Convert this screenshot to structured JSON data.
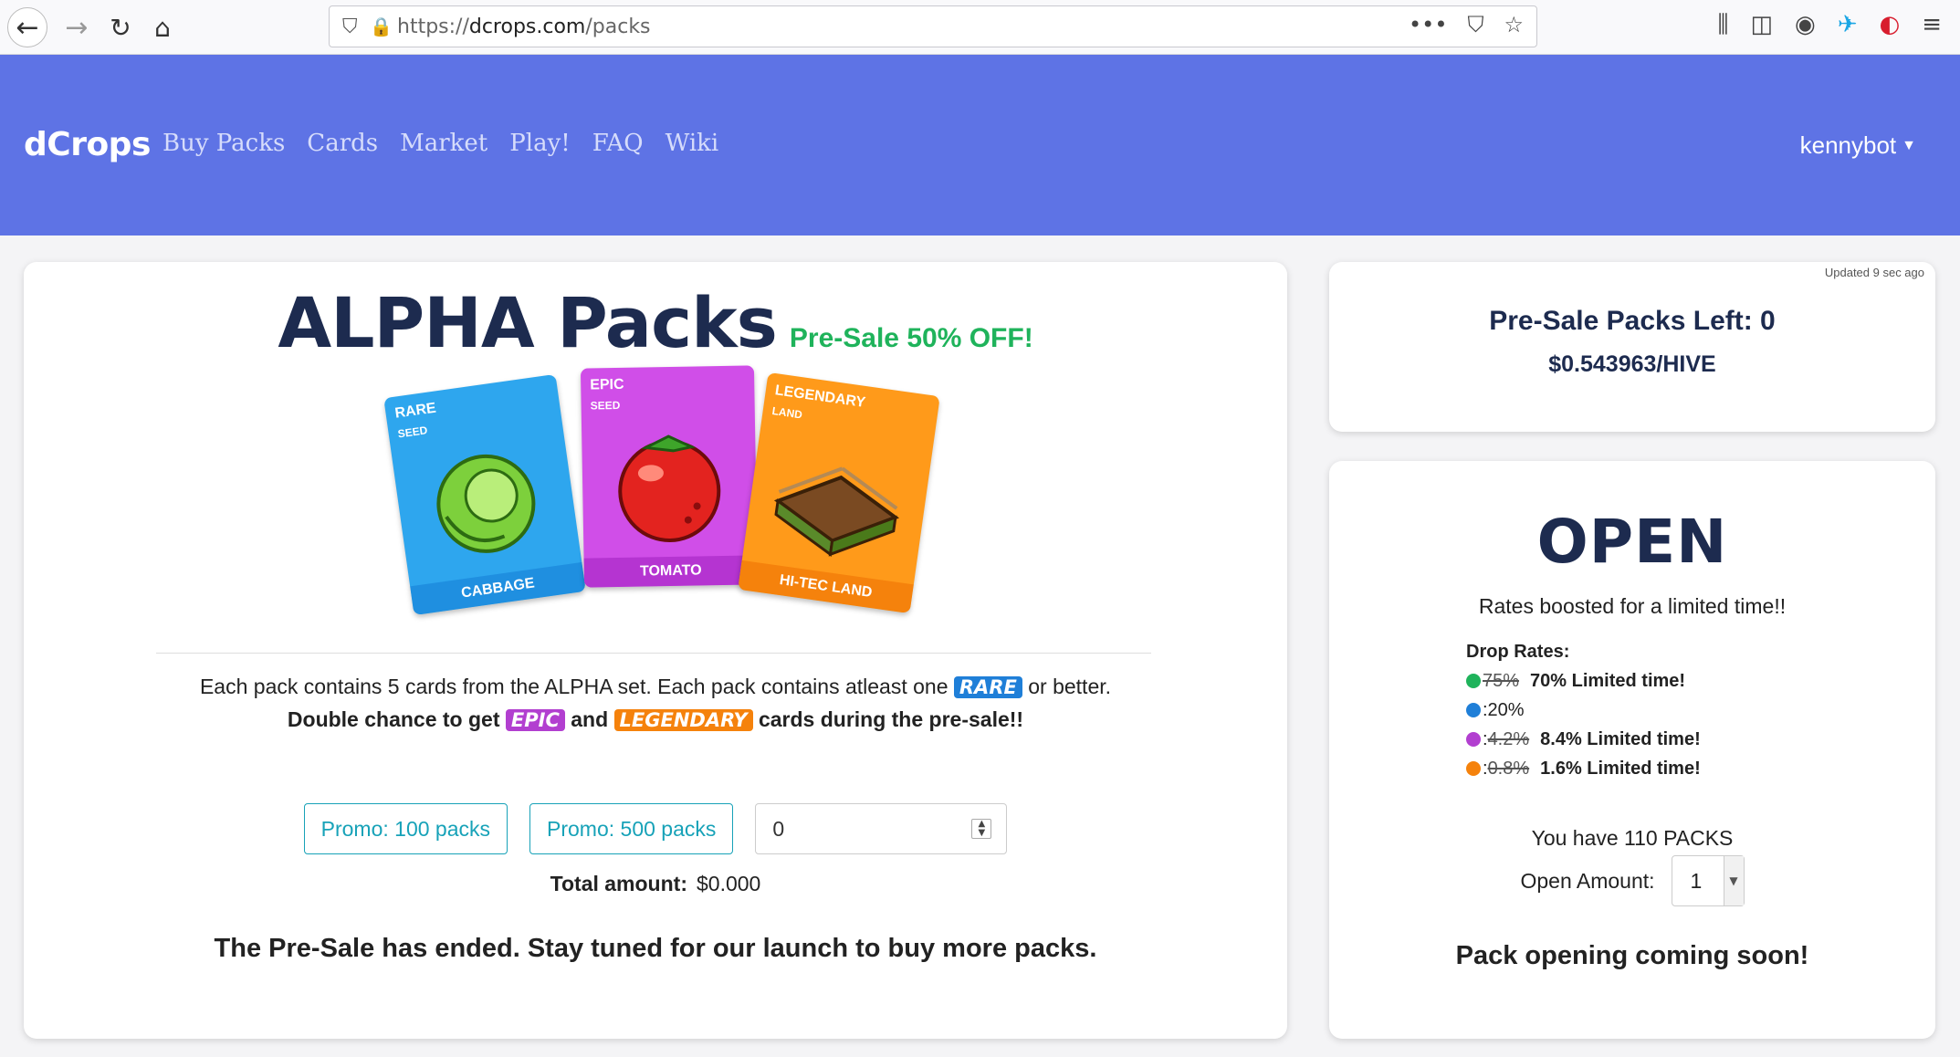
{
  "browser": {
    "url_prefix": "https://",
    "url_host": "dcrops.com",
    "url_path": "/packs",
    "icons": [
      "back-icon",
      "forward-icon",
      "reload-icon",
      "home-icon",
      "shield-icon",
      "lock-icon",
      "more-icon",
      "pocket-icon",
      "star-icon",
      "library-icon",
      "sidebar-icon",
      "account-icon",
      "extension-icon",
      "extension-icon",
      "menu-icon"
    ]
  },
  "nav": {
    "brand": "dCrops",
    "links": [
      "Buy Packs",
      "Cards",
      "Market",
      "Play!",
      "FAQ",
      "Wiki"
    ],
    "user": "kennybot"
  },
  "main": {
    "title": "ALPHA Packs",
    "sale_badge": "Pre-Sale 50% OFF!",
    "cards": [
      {
        "rarity": "RARE",
        "type": "SEED",
        "name": "CABBAGE"
      },
      {
        "rarity": "EPIC",
        "type": "SEED",
        "name": "TOMATO"
      },
      {
        "rarity": "LEGENDARY",
        "type": "LAND",
        "name": "HI-TEC LAND"
      }
    ],
    "desc_part1": "Each pack contains 5 cards from the ALPHA set. Each pack contains atleast one",
    "desc_rare": "RARE",
    "desc_part2": "or better.",
    "double_part1": "Double chance to get",
    "double_epic": "EPIC",
    "double_and": "and",
    "double_legendary": "LEGENDARY",
    "double_part2": "cards during the pre-sale!!",
    "promo_100": "Promo: 100 packs",
    "promo_500": "Promo: 500 packs",
    "quantity": "0",
    "total_label": "Total amount:",
    "total_value": "$0.000",
    "ended": "The Pre-Sale has ended. Stay tuned for our launch to buy more packs."
  },
  "rates": {
    "updated": "Updated 9 sec ago",
    "packs_left": "Pre-Sale Packs Left: 0",
    "price": "$0.543963/HIVE"
  },
  "open": {
    "title": "OPEN",
    "boost": "Rates boosted for a limited time!!",
    "drop_title": "Drop Rates:",
    "rows": [
      {
        "color": "#1fb35b",
        "prefix": "",
        "old": "75%",
        "new": "70% Limited time!"
      },
      {
        "color": "#1f7fd8",
        "prefix": ":20%",
        "old": "",
        "new": ""
      },
      {
        "color": "#b23fd0",
        "prefix": ": ",
        "old": "4.2%",
        "new": "8.4% Limited time!"
      },
      {
        "color": "#f5820c",
        "prefix": ": ",
        "old": "0.8%",
        "new": "1.6% Limited time!"
      }
    ],
    "have": "You have 110 PACKS",
    "open_amount_label": "Open Amount:",
    "open_amount_value": "1",
    "soon": "Pack opening coming soon!"
  }
}
